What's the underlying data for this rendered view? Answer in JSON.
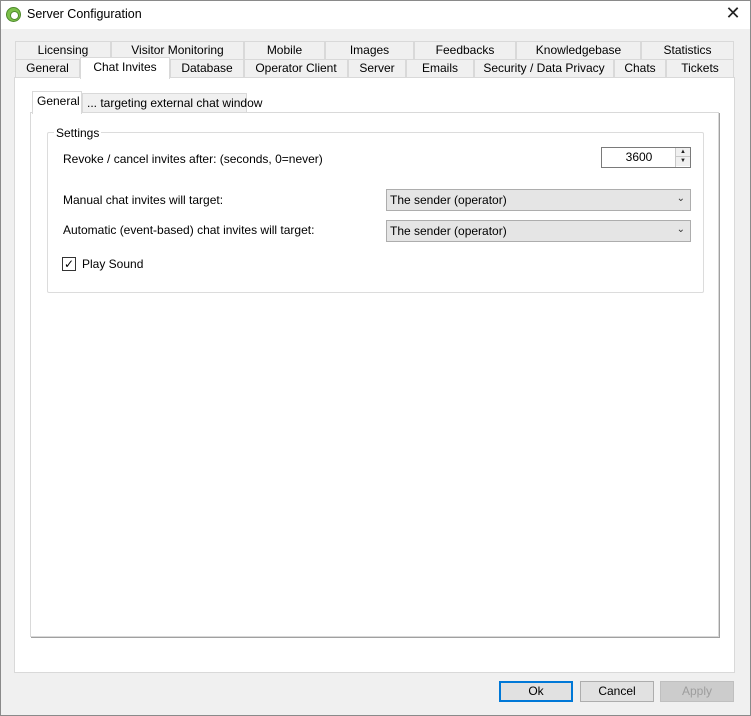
{
  "window": {
    "title": "Server Configuration",
    "close_glyph": "✕",
    "icon": "gear-icon"
  },
  "main_tabs": {
    "row1": [
      "Licensing",
      "Visitor Monitoring",
      "Mobile",
      "Images",
      "Feedbacks",
      "Knowledgebase",
      "Statistics"
    ],
    "row2": [
      "General",
      "Chat Invites",
      "Database",
      "Operator Client",
      "Server",
      "Emails",
      "Security / Data Privacy",
      "Chats",
      "Tickets"
    ],
    "active": "Chat Invites"
  },
  "inner_tabs": {
    "items": [
      "General",
      "... targeting external chat window"
    ],
    "active": "General"
  },
  "settings": {
    "group_label": "Settings",
    "revoke_label": "Revoke / cancel invites after: (seconds, 0=never)",
    "revoke_value": "3600",
    "spin_up_glyph": "▲",
    "spin_down_glyph": "▼",
    "manual_label": "Manual chat invites will target:",
    "manual_value": "The sender (operator)",
    "auto_label": "Automatic (event-based) chat invites will target:",
    "auto_value": "The sender (operator)",
    "combo_arrow_glyph": "⌄",
    "play_sound_label": "Play Sound",
    "play_sound_checked": true,
    "check_glyph": "✓"
  },
  "buttons": {
    "ok": "Ok",
    "cancel": "Cancel",
    "apply": "Apply"
  }
}
